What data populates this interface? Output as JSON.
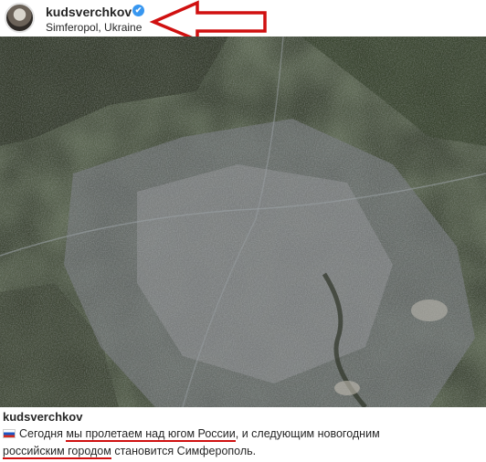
{
  "post": {
    "username": "kudsverchkov",
    "location": "Simferopol, Ukraine",
    "verified_glyph": "✔"
  },
  "caption": {
    "username": "kudsverchkov",
    "flag_icon": "russia-flag-icon",
    "part1": "Сегодня",
    "part2": "мы пролетаем над югом России",
    "part3": ", и следующим новогодним",
    "part4": "российским городом",
    "part5": "становится Симферополь."
  },
  "colors": {
    "annotation_red": "#d01010",
    "verified_blue": "#3897f0"
  }
}
